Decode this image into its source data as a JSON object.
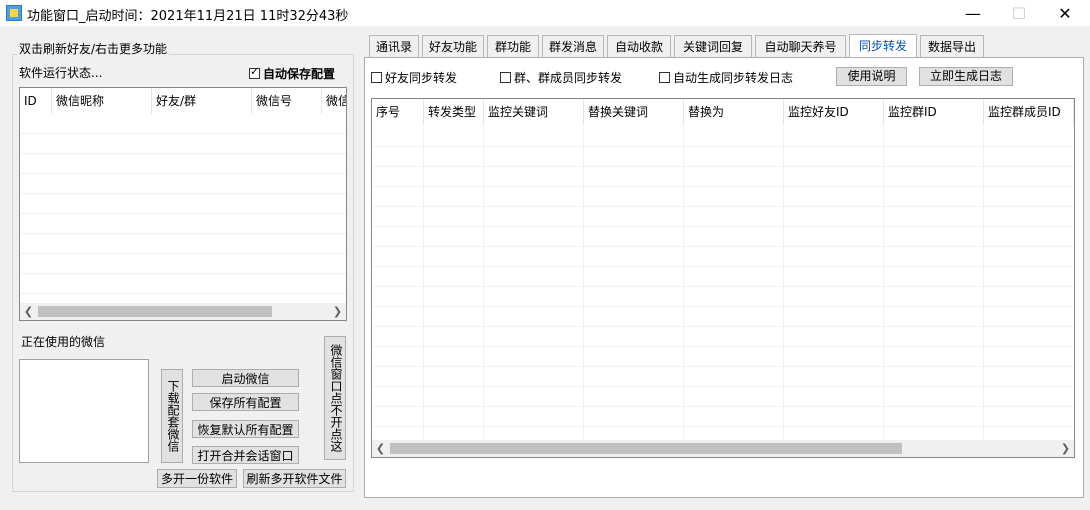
{
  "window": {
    "title": "功能窗口_启动时间：2021年11月21日 11时32分43秒",
    "minimize": "—",
    "maximize": "☐",
    "close": "✕"
  },
  "left": {
    "group_title": "双击刷新好友/右击更多功能",
    "status_label": "软件运行状态...",
    "auto_save_label": "自动保存配置",
    "auto_save_checked": true,
    "columns": [
      "ID",
      "微信昵称",
      "好友/群",
      "微信号",
      "微信"
    ],
    "in_use_label": "正在使用的微信",
    "download_button": "下载配套微信",
    "start_wechat": "启动微信",
    "save_all": "保存所有配置",
    "restore_default": "恢复默认所有配置",
    "open_merge": "打开合并会话窗口",
    "window_click_button": "微信窗口点不开点这",
    "multi_open": "多开一份软件",
    "refresh_multi": "刷新多开软件文件"
  },
  "tabs": [
    "通讯录",
    "好友功能",
    "群功能",
    "群发消息",
    "自动收款",
    "关键词回复",
    "自动聊天养号",
    "同步转发",
    "数据导出"
  ],
  "active_tab": "同步转发",
  "sync": {
    "friend_sync": "好友同步转发",
    "group_sync": "群、群成员同步转发",
    "auto_log": "自动生成同步转发日志",
    "usage_button": "使用说明",
    "gen_log_button": "立即生成日志",
    "columns": [
      "序号",
      "转发类型",
      "监控关键词",
      "替换关键词",
      "替换为",
      "监控好友ID",
      "监控群ID",
      "监控群成员ID"
    ]
  },
  "colors": {
    "active_tab_text": "#0a4fa8",
    "list_border": "#828790"
  }
}
